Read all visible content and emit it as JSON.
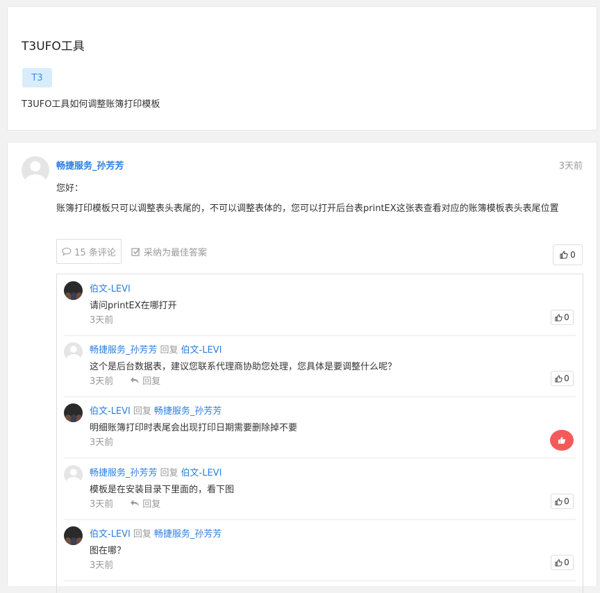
{
  "question": {
    "title": "T3UFO工具",
    "tag": "T3",
    "description": "T3UFO工具如何调整账簿打印模板"
  },
  "answer": {
    "author": "畅捷服务_孙芳芳",
    "time": "3天前",
    "greeting": "您好：",
    "body": "账簿打印模板只可以调整表头表尾的，不可以调整表体的，您可以打开后台表printEX这张表查看对应的账簿模板表头表尾位置",
    "comments_label": "15 条评论",
    "accept_label": "采纳为最佳答案",
    "likes": "0"
  },
  "comments": [
    {
      "author": "伯文-LEVI",
      "reply_word": "",
      "reply_to": "",
      "text": "请问printEX在哪打开",
      "time": "3天前",
      "reply_label": "",
      "likes": "0",
      "avatar": "photo"
    },
    {
      "author": "畅捷服务_孙芳芳",
      "reply_word": "回复",
      "reply_to": "伯文-LEVI",
      "text": "这个是后台数据表，建议您联系代理商协助您处理，您具体是要调整什么呢？",
      "time": "3天前",
      "reply_label": "回复",
      "likes": "0",
      "avatar": "default"
    },
    {
      "author": "伯文-LEVI",
      "reply_word": "回复",
      "reply_to": "畅捷服务_孙芳芳",
      "text": "明细账簿打印时表尾会出现打印日期需要删除掉不要",
      "time": "3天前",
      "reply_label": "",
      "likes": "",
      "avatar": "photo"
    },
    {
      "author": "畅捷服务_孙芳芳",
      "reply_word": "回复",
      "reply_to": "伯文-LEVI",
      "text": "模板是在安装目录下里面的，看下图",
      "time": "3天前",
      "reply_label": "回复",
      "likes": "0",
      "avatar": "default"
    },
    {
      "author": "伯文-LEVI",
      "reply_word": "回复",
      "reply_to": "畅捷服务_孙芳芳",
      "text": "图在哪？",
      "time": "3天前",
      "reply_label": "",
      "likes": "0",
      "avatar": "photo"
    }
  ]
}
